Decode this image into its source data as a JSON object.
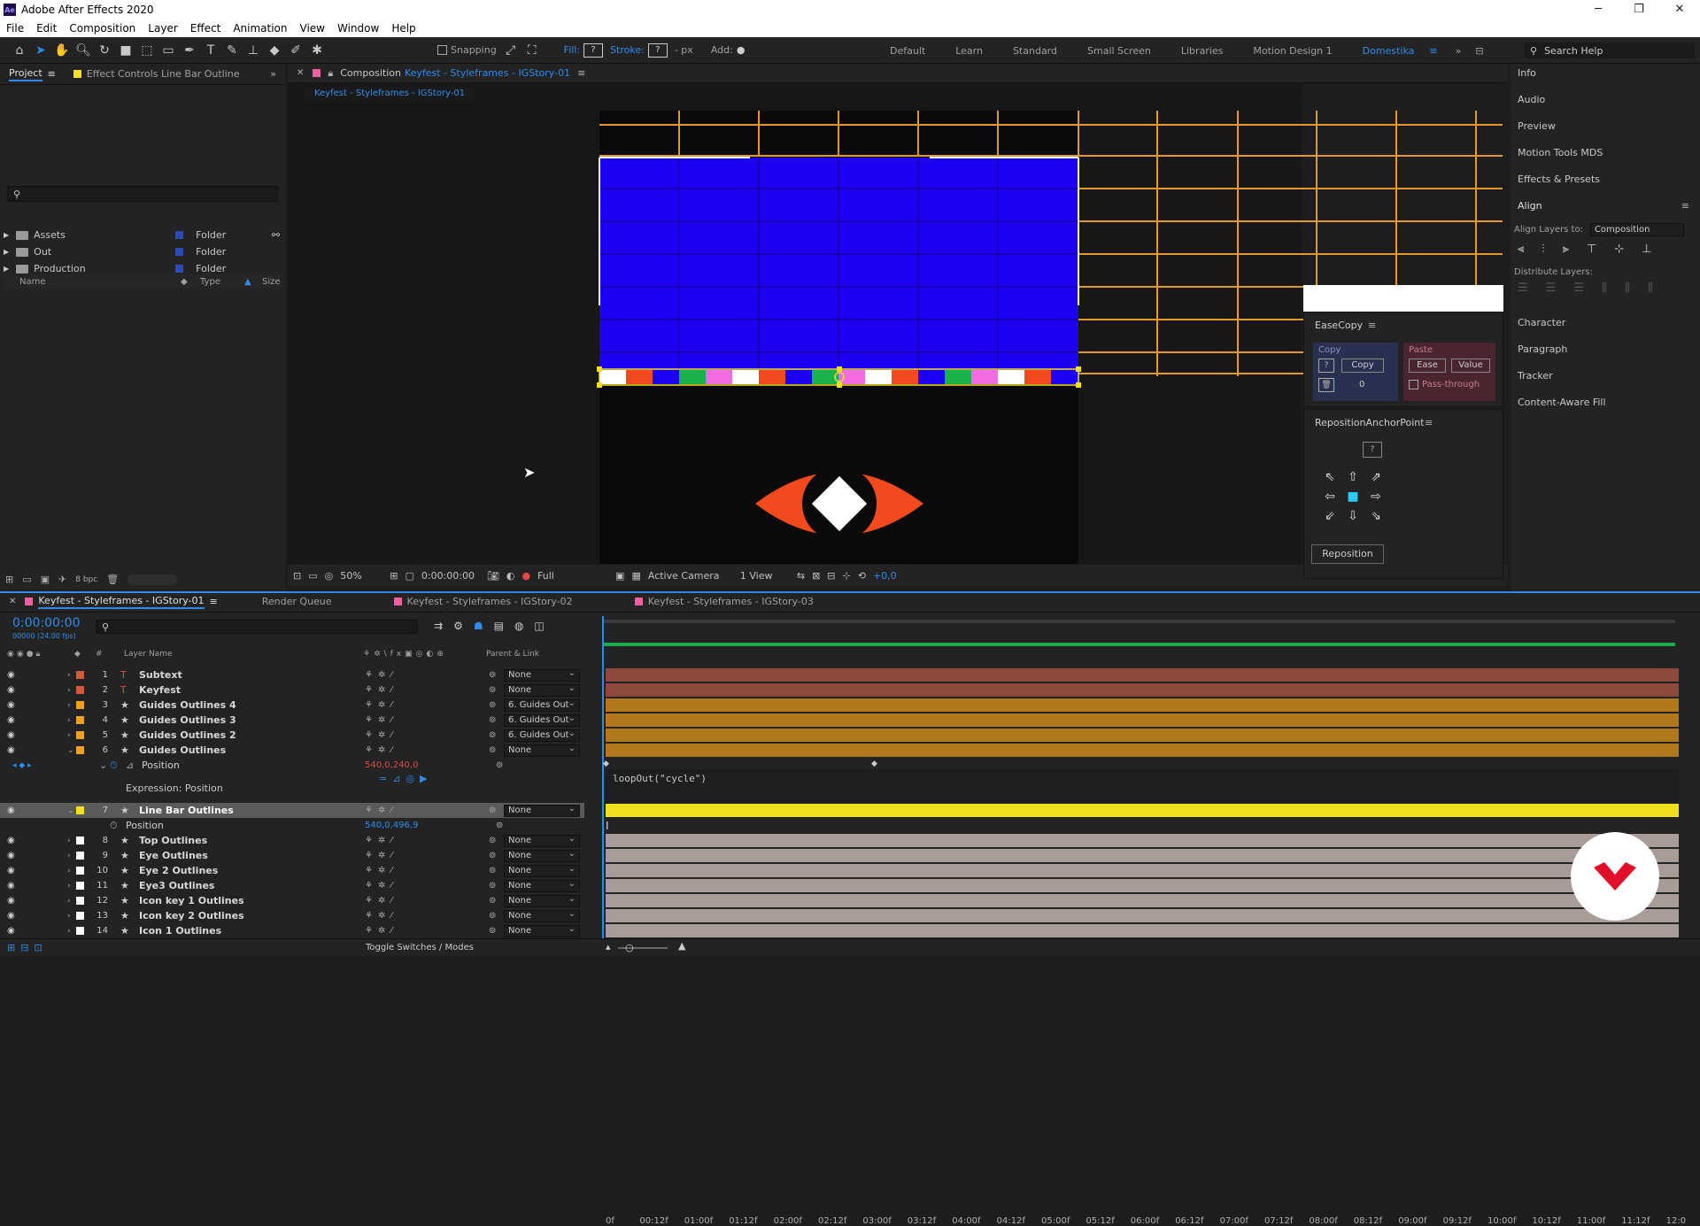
{
  "window": {
    "title": "Adobe After Effects 2020",
    "app_icon": "Ae",
    "controls": [
      "─",
      "❐",
      "✕"
    ]
  },
  "menu": [
    "File",
    "Edit",
    "Composition",
    "Layer",
    "Effect",
    "Animation",
    "View",
    "Window",
    "Help"
  ],
  "toolbar": {
    "snapping_label": "Snapping",
    "fill_label": "Fill:",
    "fill_value": "?",
    "stroke_label": "Stroke:",
    "stroke_value": "?",
    "stroke_unit": "- px",
    "add_label": "Add:",
    "workspaces": [
      "Default",
      "Learn",
      "Standard",
      "Small Screen",
      "Libraries",
      "Motion Design 1",
      "Domestika"
    ],
    "active_workspace": "Domestika",
    "search_help": "Search Help"
  },
  "project_panel": {
    "tab_project": "Project",
    "tab_effect_controls": "Effect Controls Line Bar Outline",
    "columns": {
      "name": "Name",
      "type": "Type",
      "size": "Size"
    },
    "items": [
      {
        "name": "Assets",
        "type": "Folder"
      },
      {
        "name": "Out",
        "type": "Folder"
      },
      {
        "name": "Production",
        "type": "Folder"
      }
    ],
    "bpc": "8 bpc"
  },
  "composition_panel": {
    "tab_prefix": "Composition",
    "tab_name": "Keyfest - Styleframes - IGStory-01",
    "breadcrumb": "Keyfest - Styleframes - IGStory-01",
    "zoom": "50%",
    "timecode": "0:00:00:00",
    "resolution": "Full",
    "camera": "Active Camera",
    "views": "1 View",
    "exposure": "+0,0"
  },
  "right_panel": {
    "items": [
      "Info",
      "Audio",
      "Preview",
      "Motion Tools MDS",
      "Effects & Presets",
      "Align"
    ],
    "align_layers_to_label": "Align Layers to:",
    "align_layers_to_value": "Composition",
    "distribute_label": "Distribute Layers:",
    "lower_items": [
      "Character",
      "Paragraph",
      "Tracker",
      "Content-Aware Fill"
    ]
  },
  "easecopy": {
    "title": "EaseCopy",
    "copy_section": "Copy",
    "copy_btn": "Copy",
    "q": "?",
    "count": "0",
    "paste_section": "Paste",
    "ease_btn": "Ease",
    "value_btn": "Value",
    "passthrough": "Pass-through"
  },
  "reposition": {
    "title": "RepositionAnchorPoint",
    "q": "?",
    "button": "Reposition"
  },
  "timeline": {
    "tabs": [
      "Keyfest - Styleframes - IGStory-01",
      "Render Queue",
      "Keyfest - Styleframes - IGStory-02",
      "Keyfest - Styleframes - IGStory-03"
    ],
    "timecode": "0:00:00:00",
    "fps": "00000 (24.00 fps)",
    "col_layer_name": "Layer Name",
    "col_parent": "Parent & Link",
    "hash": "#",
    "ruler": [
      "0f",
      "00:12f",
      "01:00f",
      "01:12f",
      "02:00f",
      "02:12f",
      "03:00f",
      "03:12f",
      "04:00f",
      "04:12f",
      "05:00f",
      "05:12f",
      "06:00f",
      "06:12f",
      "07:00f",
      "07:12f",
      "08:00f",
      "08:12f",
      "09:00f",
      "09:12f",
      "10:00f",
      "10:12f",
      "11:00f",
      "11:12f",
      "12:0"
    ],
    "layers_top": [
      {
        "num": "1",
        "name": "Subtext",
        "parent": "None",
        "color": "#d05a3a",
        "bar": "#8c4a3c",
        "kind": "text"
      },
      {
        "num": "2",
        "name": "Keyfest",
        "parent": "None",
        "color": "#d05a3a",
        "bar": "#8c4a3c",
        "kind": "text"
      },
      {
        "num": "3",
        "name": "Guides Outlines 4",
        "parent": "6. Guides Out",
        "color": "#f0a020",
        "bar": "#b07a1c",
        "kind": "shape"
      },
      {
        "num": "4",
        "name": "Guides Outlines 3",
        "parent": "6. Guides Out",
        "color": "#f0a020",
        "bar": "#b07a1c",
        "kind": "shape"
      },
      {
        "num": "5",
        "name": "Guides Outlines 2",
        "parent": "6. Guides Out",
        "color": "#f0a020",
        "bar": "#b07a1c",
        "kind": "shape"
      },
      {
        "num": "6",
        "name": "Guides Outlines",
        "parent": "None",
        "color": "#f0a020",
        "bar": "#b07a1c",
        "kind": "shape"
      }
    ],
    "position_prop": {
      "label": "Position",
      "value": "540,0,240,0"
    },
    "expression_label": "Expression: Position",
    "expression_code": "loopOut(\"cycle\")",
    "selected_layer": {
      "num": "7",
      "name": "Line Bar Outlines",
      "parent": "None",
      "color": "#f0e020"
    },
    "selected_position": {
      "label": "Position",
      "value": "540,0,496,9"
    },
    "layers_bottom": [
      {
        "num": "8",
        "name": "Top Outlines",
        "parent": "None"
      },
      {
        "num": "9",
        "name": "Eye Outlines",
        "parent": "None"
      },
      {
        "num": "10",
        "name": "Eye 2 Outlines",
        "parent": "None"
      },
      {
        "num": "11",
        "name": "Eye3 Outlines",
        "parent": "None"
      },
      {
        "num": "12",
        "name": "Icon key 1 Outlines",
        "parent": "None"
      },
      {
        "num": "13",
        "name": "Icon key 2 Outlines",
        "parent": "None"
      },
      {
        "num": "14",
        "name": "Icon 1 Outlines",
        "parent": "None"
      }
    ],
    "toggle_label": "Toggle Switches / Modes"
  },
  "colors": {
    "accent": "#2d8ceb",
    "comp_blue": "#1e00f0",
    "guide_orange": "#e19a2c",
    "eye_orange": "#f04a1e",
    "selected_bar": "#f0e020",
    "gray_bar": "#a89c98"
  }
}
